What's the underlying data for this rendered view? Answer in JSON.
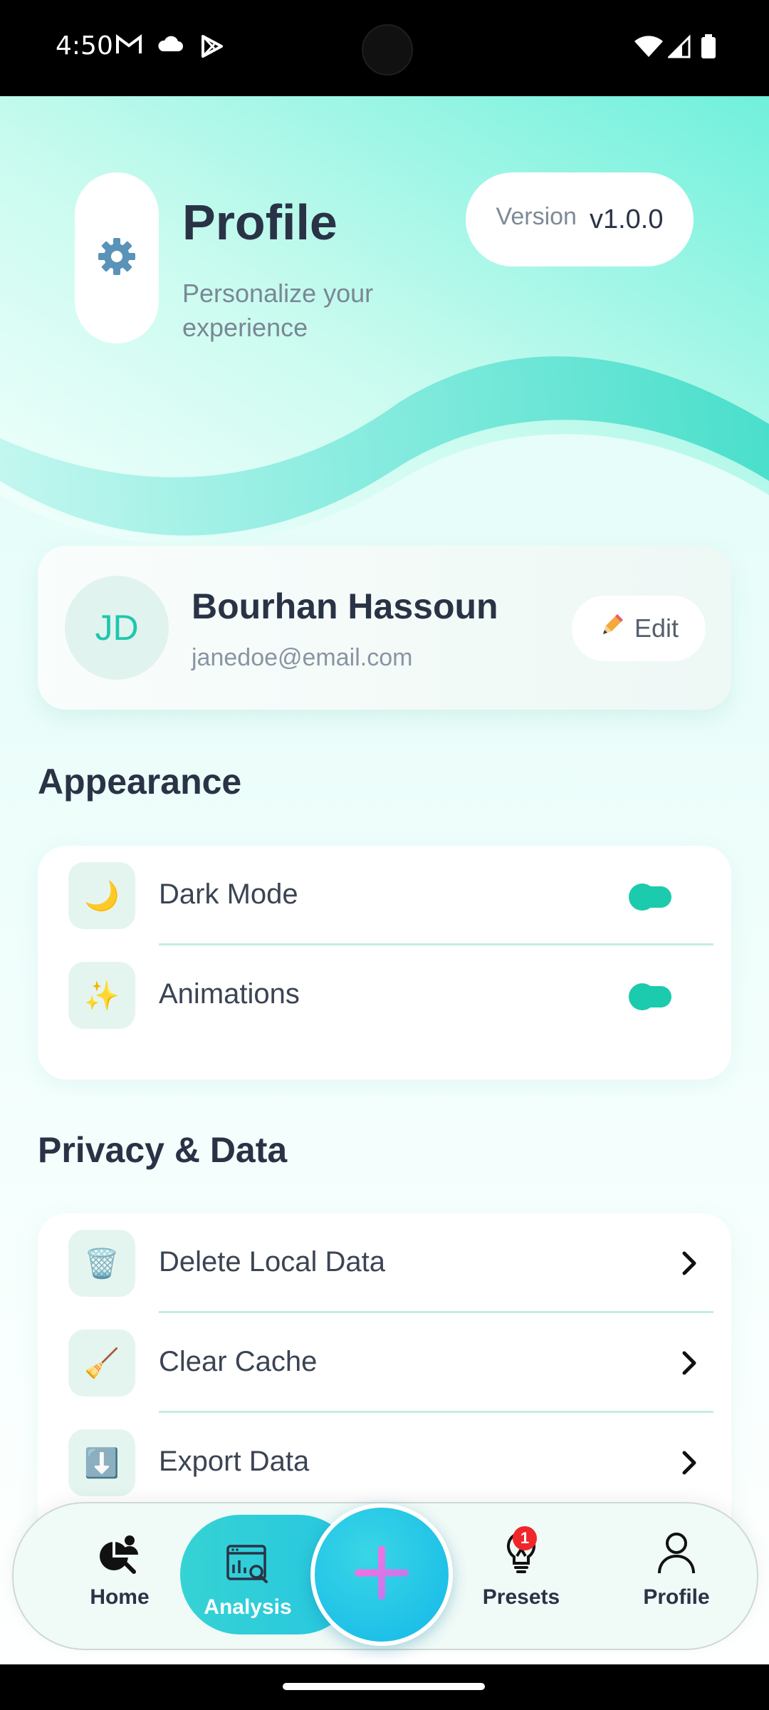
{
  "status_bar": {
    "time": "4:50"
  },
  "header": {
    "title": "Profile",
    "subtitle": "Personalize your experience",
    "version_label": "Version",
    "version_value": "v1.0.0"
  },
  "user": {
    "initials": "JD",
    "name": "Bourhan Hassoun",
    "email": "janedoe@email.com",
    "edit_label": "Edit"
  },
  "appearance": {
    "title": "Appearance",
    "items": [
      {
        "icon": "moon-icon",
        "emoji": "🌙",
        "label": "Dark Mode",
        "enabled": true
      },
      {
        "icon": "sparkles-icon",
        "emoji": "✨",
        "label": "Animations",
        "enabled": true
      }
    ]
  },
  "privacy": {
    "title": "Privacy & Data",
    "items": [
      {
        "icon": "trash-icon",
        "emoji": "🗑️",
        "label": "Delete Local Data"
      },
      {
        "icon": "broom-icon",
        "emoji": "🧹",
        "label": "Clear Cache"
      },
      {
        "icon": "download-icon",
        "emoji": "⬇️",
        "label": "Export Data"
      }
    ]
  },
  "nav": {
    "items": [
      {
        "label": "Home",
        "icon": "home-icon"
      },
      {
        "label": "Analysis",
        "icon": "analysis-icon",
        "active": true
      },
      {
        "label": "Presets",
        "icon": "lightbulb-icon",
        "badge": "1"
      },
      {
        "label": "Profile",
        "icon": "person-icon"
      }
    ],
    "fab_icon": "plus-icon"
  },
  "colors": {
    "accent": "#1CCAAD",
    "fab": "#13B8E8",
    "text": "#2A3346",
    "badge": "#F0262A"
  }
}
